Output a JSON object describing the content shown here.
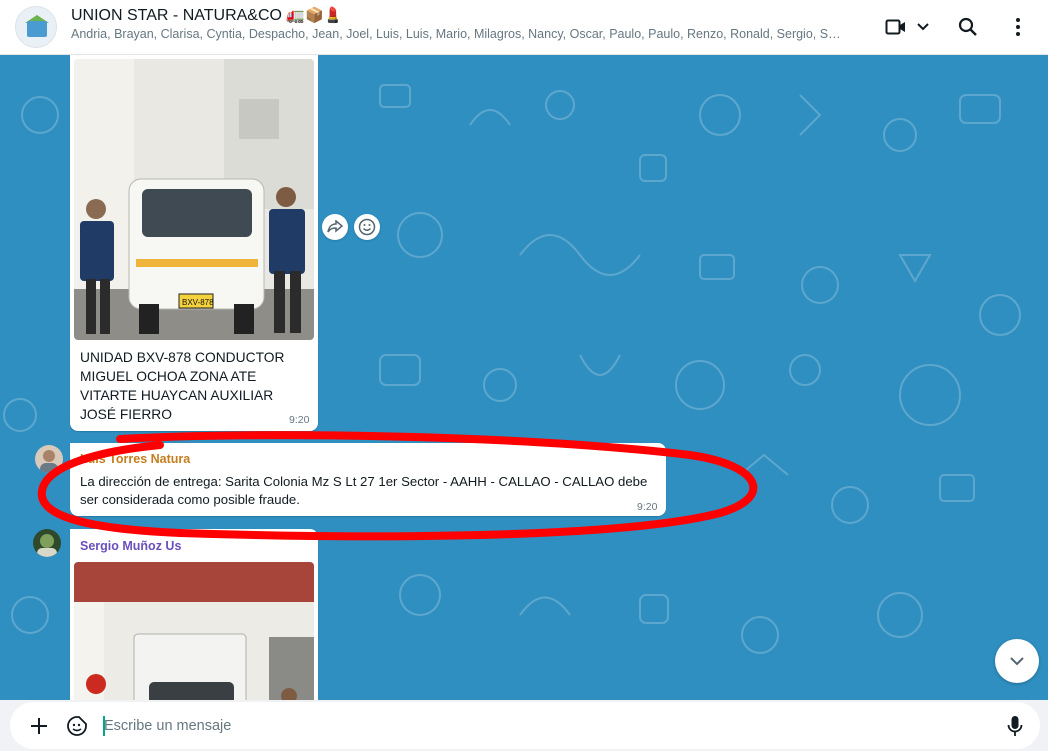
{
  "header": {
    "title": "UNION STAR - NATURA&CO",
    "title_emojis": "🚛📦💄",
    "members": "Andria, Brayan, Clarisa, Cyntia, Despacho, Jean, Joel, Luis, Luis, Mario, Milagros, Nancy, Oscar, Paulo, Paulo, Renzo, Ronald, Sergio, Ser..."
  },
  "messages": [
    {
      "type": "image",
      "caption": "UNIDAD BXV-878 CONDUCTOR MIGUEL OCHOA ZONA ATE VITARTE HUAYCAN AUXILIAR JOSÉ FIERRO",
      "time": "9:20",
      "plate": "BXV-878"
    },
    {
      "type": "text",
      "sender": "Luis Torres Natura",
      "sender_color": "#c77d1e",
      "text": "La dirección de entrega: Sarita Colonia Mz S Lt 27 1er Sector - AAHH - CALLAO - CALLAO debe ser considerada como posible fraude.",
      "time": "9:20"
    },
    {
      "type": "image",
      "sender": "Sergio Muñoz Us",
      "sender_color": "#6b4fbb"
    }
  ],
  "composer": {
    "placeholder": "Escribe un mensaje"
  },
  "colors": {
    "wallpaper": "#2f8fc0",
    "annotation": "#ff0000",
    "accent": "#00a884"
  },
  "icons": [
    "video-call-icon",
    "chevron-down-icon",
    "search-icon",
    "kebab-menu-icon",
    "forward-icon",
    "emoji-react-icon",
    "plus-icon",
    "sticker-icon",
    "mic-icon",
    "scroll-down-icon"
  ]
}
